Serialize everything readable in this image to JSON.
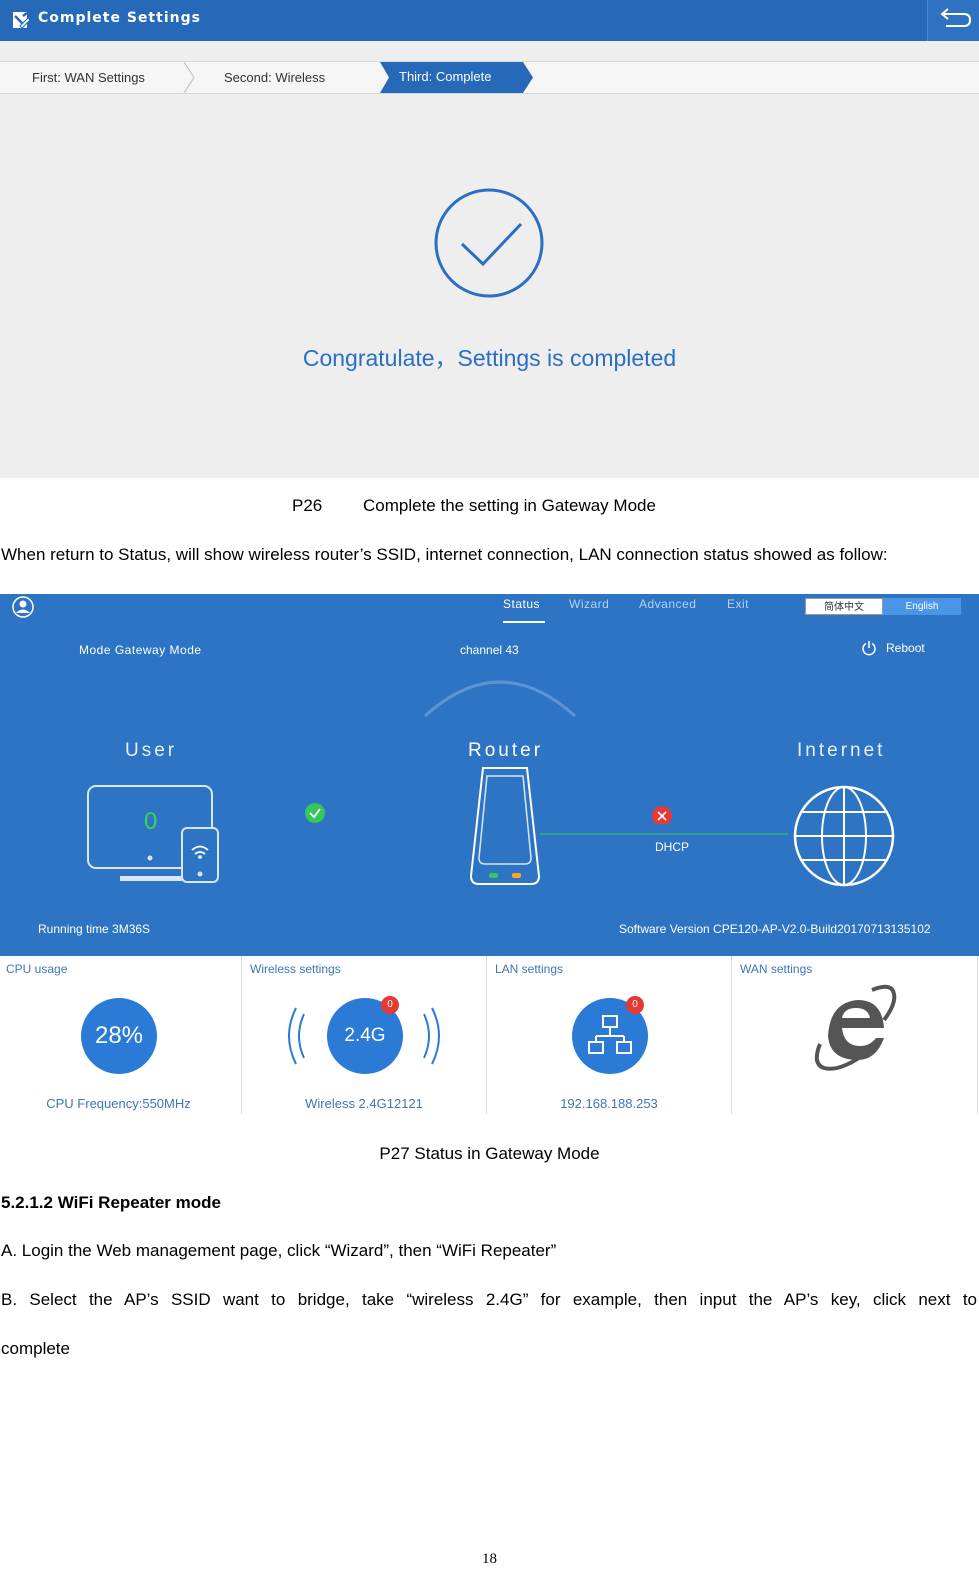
{
  "settings_screen": {
    "title": "Complete Settings",
    "steps": [
      "First: WAN Settings",
      "Second: Wireless",
      "Third: Complete"
    ],
    "message": "Congratulate，Settings is completed",
    "colors": {
      "header": "#2769b9",
      "accent": "#2a6fc2"
    }
  },
  "captions": {
    "p26_number": "P26",
    "p26_text": "Complete the setting in Gateway Mode",
    "p27": "P27 Status in Gateway Mode"
  },
  "paragraphs": {
    "status_intro": "When return to Status, will show wireless router’s SSID, internet connection, LAN connection status showed as follow:",
    "heading": "5.2.1.2 WiFi Repeater mode",
    "step_a": "A. Login the Web management page, click “Wizard”, then “WiFi Repeater”",
    "step_b_line1": "B. Select the AP’s SSID want to bridge, take “wireless 2.4G” for example, then input the AP’s key, click next to",
    "step_b_line2": "complete"
  },
  "status_screen": {
    "nav": [
      "Status",
      "Wizard",
      "Advanced",
      "Exit"
    ],
    "languages": [
      "简体中文",
      "English"
    ],
    "mode": "Mode  Gateway Mode",
    "channel": "channel 43",
    "reboot": "Reboot",
    "labels": {
      "user": "User",
      "router": "Router",
      "internet": "Internet"
    },
    "user_count": "0",
    "dhcp": "DHCP",
    "running_time": "Running time  3M36S",
    "software_version": "Software Version  CPE120-AP-V2.0-Build20170713135102",
    "panels": {
      "cpu": {
        "title": "CPU usage",
        "value": "28%",
        "footer": "CPU Frequency:550MHz"
      },
      "wireless": {
        "title": "Wireless settings",
        "value": "2.4G",
        "badge": "0",
        "footer": "Wireless 2.4G12121"
      },
      "lan": {
        "title": "LAN settings",
        "badge": "0",
        "footer": "192.168.188.253"
      },
      "wan": {
        "title": "WAN settings"
      }
    },
    "colors": {
      "top": "#2e74c5",
      "circle": "#2a7ad6",
      "ok": "#34c759",
      "error": "#e53935"
    }
  },
  "page_number": "18"
}
